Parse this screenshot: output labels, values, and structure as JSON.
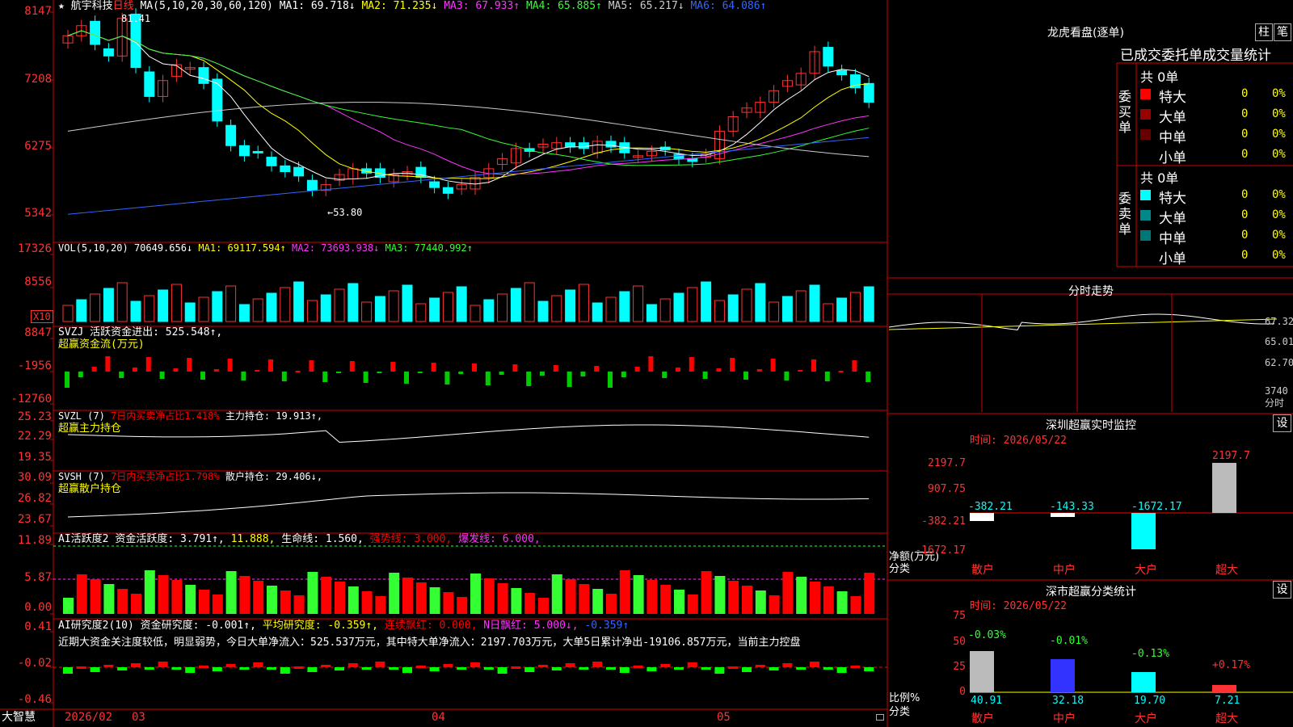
{
  "stock": {
    "star": "★",
    "name": "航宇科技",
    "period": "日线",
    "high_mark": "81.41",
    "low_mark": "←53.80"
  },
  "main_panel": {
    "ma_header": "MA(5,10,20,30,60,120)",
    "ma_items": [
      {
        "label": "MA1: 69.718↓",
        "color": "#ffffff"
      },
      {
        "label": "MA2: 71.235↓",
        "color": "#ffff00"
      },
      {
        "label": "MA3: 67.933↑",
        "color": "#ff33ff"
      },
      {
        "label": "MA4: 65.885↑",
        "color": "#33ff33"
      },
      {
        "label": "MA5: 65.217↓",
        "color": "#cccccc"
      },
      {
        "label": "MA6: 64.086↑",
        "color": "#3366ff"
      }
    ],
    "y_labels": [
      "8147",
      "7208",
      "6275",
      "5342"
    ]
  },
  "vol_panel": {
    "header": "VOL(5,10,20)",
    "value": "70649.656↓",
    "ma_items": [
      {
        "label": "MA1: 69117.594↑",
        "color": "#ffff00"
      },
      {
        "label": "MA2: 73693.938↓",
        "color": "#ff33ff"
      },
      {
        "label": "MA3: 77440.992↑",
        "color": "#33ff33"
      }
    ],
    "y_labels": [
      "17326",
      "8556"
    ],
    "unit": "X10"
  },
  "svzj_panel": {
    "line1": "SVZJ  活跃资金进出: 525.548↑,",
    "line2": "超赢资金流(万元)",
    "y_labels": [
      "8847",
      "-1956",
      "-12760"
    ]
  },
  "svzl_panel": {
    "prefix": "SVZL (7)",
    "ratio": "7日内买卖净占比1.418%",
    "holding": "主力持仓: 19.913↑,",
    "line2": "超赢主力持仓",
    "y_labels": [
      "25.23",
      "22.29",
      "19.35"
    ]
  },
  "svsh_panel": {
    "prefix": "SVSH (7)",
    "ratio": "7日内买卖净占比1.798%",
    "holding": "散户持仓: 29.406↓,",
    "line2": "超赢散户持仓",
    "y_labels": [
      "30.09",
      "26.82",
      "23.67"
    ]
  },
  "ai_active_panel": {
    "prefix": "AI活跃度2",
    "active": "资金活跃度: 3.791↑,",
    "val2": "11.888,",
    "life": "生命线: 1.560,",
    "strong": "强势线: 3.000,",
    "burst": "爆发线: 6.000,",
    "y_labels": [
      "11.89",
      "5.87",
      "0.00"
    ]
  },
  "ai_research_panel": {
    "prefix": "AI研究度2(10)",
    "research": "资金研究度: -0.001↑,",
    "avg": "平均研究度: -0.359↑,",
    "consec": "连续飘红: 0.000,",
    "nday": "N日飘红: 5.000↓,",
    "last": "-0.359↑",
    "commentary": "近期大资金关注度较低，明显弱势，今日大单净流入：525.537万元，其中特大单净流入：2197.703万元，大单5日累计净出-19106.857万元，当前主力控盘",
    "y_labels": [
      "0.41",
      "-0.02",
      "-0.46"
    ]
  },
  "x_axis": {
    "brand": "大智慧",
    "labels": [
      "2026/02",
      "03",
      "04",
      "05"
    ]
  },
  "dragon_tiger": {
    "title": "龙虎看盘(逐单)",
    "btn_column": "柱",
    "btn_pen": "笔",
    "tabs": "已成交委托单成交量统计",
    "buy_side_label": "委买单",
    "sell_side_label": "委卖单",
    "buy_total": "共 0单",
    "sell_total": "共 0单",
    "buy_rows": [
      {
        "label": "特大",
        "count": "0",
        "pct": "0%",
        "color": "#ff0000"
      },
      {
        "label": "大单",
        "count": "0",
        "pct": "0%",
        "color": "#990000"
      },
      {
        "label": "中单",
        "count": "0",
        "pct": "0%",
        "color": "#660000"
      },
      {
        "label": "小单",
        "count": "0",
        "pct": "0%",
        "color": ""
      }
    ],
    "sell_rows": [
      {
        "label": "特大",
        "count": "0",
        "pct": "0%",
        "color": "#00ffff"
      },
      {
        "label": "大单",
        "count": "0",
        "pct": "0%",
        "color": "#008888"
      },
      {
        "label": "中单",
        "count": "0",
        "pct": "0%",
        "color": "#007777"
      },
      {
        "label": "小单",
        "count": "0",
        "pct": "0%",
        "color": ""
      }
    ]
  },
  "intraday": {
    "title": "分时走势",
    "y_labels": [
      "67.32",
      "65.01",
      "62.70"
    ],
    "vol_label": "3740",
    "vol_unit": "分时"
  },
  "sz_monitor": {
    "title": "深圳超赢实时监控",
    "btn": "设",
    "time": "时间: 2026/05/22",
    "y_labels": [
      "2197.7",
      "907.75",
      "-382.21",
      "-1672.17"
    ],
    "net_label": "净额(万元)",
    "cat_label": "分类",
    "bars": [
      {
        "cat": "散户",
        "value": "-382.21"
      },
      {
        "cat": "中户",
        "value": "-143.33"
      },
      {
        "cat": "大户",
        "value": "-1672.17"
      },
      {
        "cat": "超大",
        "value": "2197.7"
      }
    ]
  },
  "sz_category": {
    "title": "深市超赢分类统计",
    "btn": "设",
    "time": "时间: 2026/05/22",
    "y_labels": [
      "75",
      "50",
      "25",
      "0"
    ],
    "ratio_label": "比例%",
    "cat_label": "分类",
    "bars": [
      {
        "cat": "散户",
        "value": "40.91",
        "change": "-0.03%"
      },
      {
        "cat": "中户",
        "value": "32.18",
        "change": "-0.01%"
      },
      {
        "cat": "大户",
        "value": "19.70",
        "change": "-0.13%"
      },
      {
        "cat": "超大",
        "value": "7.21",
        "change": "+0.17%"
      }
    ]
  },
  "colors": {
    "up": "#ff3333",
    "down": "#00ffff",
    "grid": "#ff0000",
    "panel_border": "#cc0000"
  }
}
